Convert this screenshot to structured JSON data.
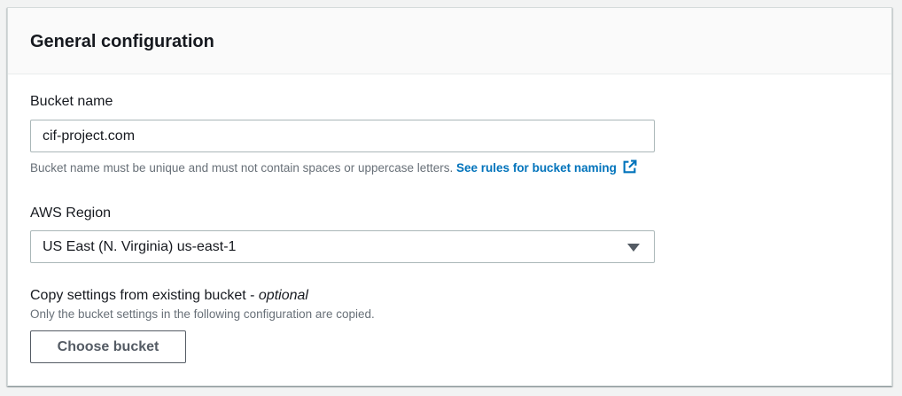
{
  "panel": {
    "title": "General configuration"
  },
  "bucket_name": {
    "label": "Bucket name",
    "value": "cif-project.com",
    "hint_text": "Bucket name must be unique and must not contain spaces or uppercase letters. ",
    "rules_link": "See rules for bucket naming",
    "link_icon": "external-link-icon"
  },
  "region": {
    "label": "AWS Region",
    "selected": "US East (N. Virginia) us-east-1",
    "icon": "caret-down-icon"
  },
  "copy_settings": {
    "label": "Copy settings from existing bucket - ",
    "label_optional": "optional",
    "hint": "Only the bucket settings in the following configuration are copied.",
    "button_label": "Choose bucket"
  },
  "colors": {
    "link": "#0073bb",
    "text": "#16191f",
    "hint": "#687078",
    "border": "#aab7b8",
    "button_border": "#545b64"
  }
}
